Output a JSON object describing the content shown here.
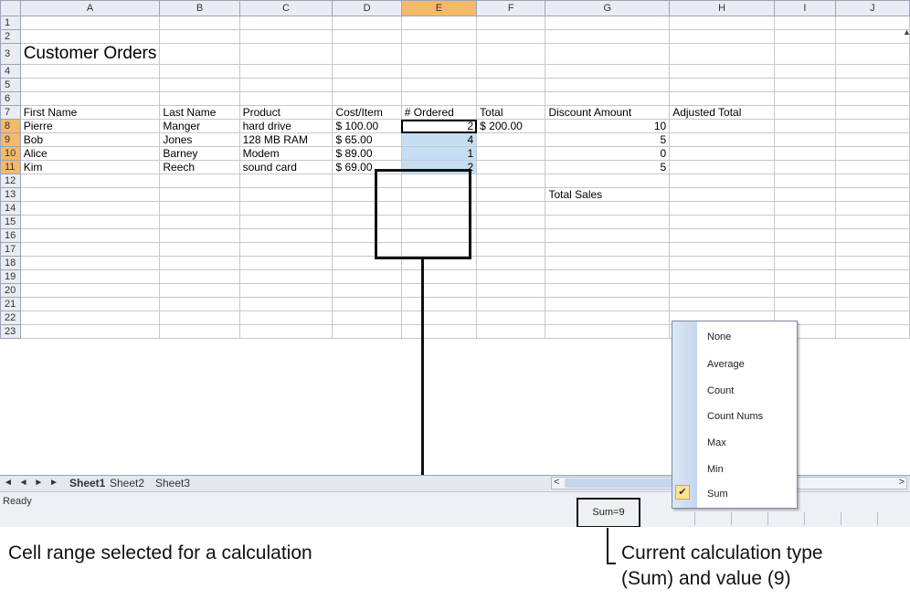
{
  "columns": [
    "A",
    "B",
    "C",
    "D",
    "E",
    "F",
    "G",
    "H",
    "I",
    "J"
  ],
  "rows": [
    "1",
    "2",
    "3",
    "4",
    "5",
    "6",
    "7",
    "8",
    "9",
    "10",
    "11",
    "12",
    "13",
    "14",
    "15",
    "16",
    "17",
    "18",
    "19",
    "20",
    "21",
    "22",
    "23"
  ],
  "title": "Customer Orders",
  "headers": {
    "first_name": "First Name",
    "last_name": "Last Name",
    "product": "Product",
    "cost_item": "Cost/Item",
    "ordered": "# Ordered",
    "total": "Total",
    "discount": "Discount Amount",
    "adjusted": "Adjusted Total"
  },
  "orders": [
    {
      "first": "Pierre",
      "last": "Manger",
      "product": "hard drive",
      "cost": "$ 100.00",
      "ordered": "2",
      "total": "$ 200.00",
      "discount": "10"
    },
    {
      "first": "Bob",
      "last": "Jones",
      "product": "128 MB RAM",
      "cost": "$  65.00",
      "ordered": "4",
      "total": "",
      "discount": "5"
    },
    {
      "first": "Alice",
      "last": "Barney",
      "product": "Modem",
      "cost": "$  89.00",
      "ordered": "1",
      "total": "",
      "discount": "0"
    },
    {
      "first": "Kim",
      "last": "Reech",
      "product": "sound card",
      "cost": "$  69.00",
      "ordered": "2",
      "total": "",
      "discount": "5"
    }
  ],
  "total_sales_label": "Total Sales",
  "sheet_tabs": {
    "nav": "◄ ◄ ► ►",
    "sheet1": "Sheet1",
    "sheet2": "Sheet2",
    "sheet3": "Sheet3"
  },
  "scroll": {
    "left": "<",
    "right": ">"
  },
  "status": {
    "ready": "Ready",
    "sum": "Sum=9"
  },
  "calc_menu": {
    "items": [
      "None",
      "Average",
      "Count",
      "Count Nums",
      "Max",
      "Min",
      "Sum"
    ],
    "checked": "Sum",
    "check_glyph": "✔"
  },
  "captions": {
    "range": "Cell range selected for a calculation",
    "type_line1": "Current calculation type",
    "type_line2": "(Sum) and value (9)"
  },
  "colors": {
    "selection": "#c6def2",
    "header_highlight": "#f5b96a",
    "menu_check": "#ffe28f"
  }
}
